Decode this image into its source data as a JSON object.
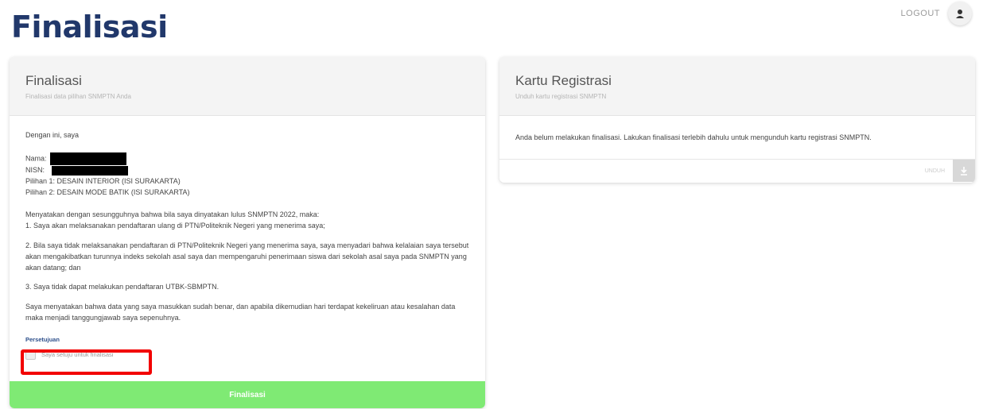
{
  "header": {
    "title": "Finalisasi",
    "logout_label": "LOGOUT"
  },
  "left_card": {
    "title": "Finalisasi",
    "subtitle": "Finalisasi data pilihan SNMPTN Anda",
    "intro": "Dengan ini, saya",
    "name_label": "Nama:",
    "nisn_label": "NISN:",
    "pilihan1": "Pilihan 1: DESAIN INTERIOR (ISI SURAKARTA)",
    "pilihan2": "Pilihan 2: DESAIN MODE BATIK (ISI SURAKARTA)",
    "statement_intro": "Menyatakan dengan sesungguhnya bahwa bila saya dinyatakan lulus SNMPTN 2022, maka:",
    "point1": "1. Saya akan melaksanakan pendaftaran ulang di PTN/Politeknik Negeri yang menerima saya;",
    "point2": "2. Bila saya tidak melaksanakan pendaftaran di PTN/Politeknik Negeri yang menerima saya, saya menyadari bahwa kelalaian saya tersebut akan mengakibatkan turunnya indeks sekolah asal saya dan mempengaruhi penerimaan siswa dari sekolah asal saya pada SNMPTN yang akan datang; dan",
    "point3": "3. Saya tidak dapat melakukan pendaftaran UTBK-SBMPTN.",
    "closing": "Saya menyatakan bahwa data yang saya masukkan sudah benar, dan apabila dikemudian hari terdapat kekeliruan atau kesalahan data maka menjadi tanggungjawab saya sepenuhnya.",
    "agreement_label": "Persetujuan",
    "checkbox_label": "Saya setuju untuk finalisasi",
    "button_label": "Finalisasi"
  },
  "right_card": {
    "title": "Kartu Registrasi",
    "subtitle": "Unduh kartu registrasi SNMPTN",
    "notice": "Anda belum melakukan finalisasi. Lakukan finalisasi terlebih dahulu untuk mengunduh kartu registrasi SNMPTN.",
    "download_label": "UNDUH"
  },
  "colors": {
    "title": "#21386b",
    "button": "#7fea74",
    "highlight": "#f20000"
  },
  "icons": {
    "avatar": "user-avatar-icon",
    "download": "download-icon"
  }
}
